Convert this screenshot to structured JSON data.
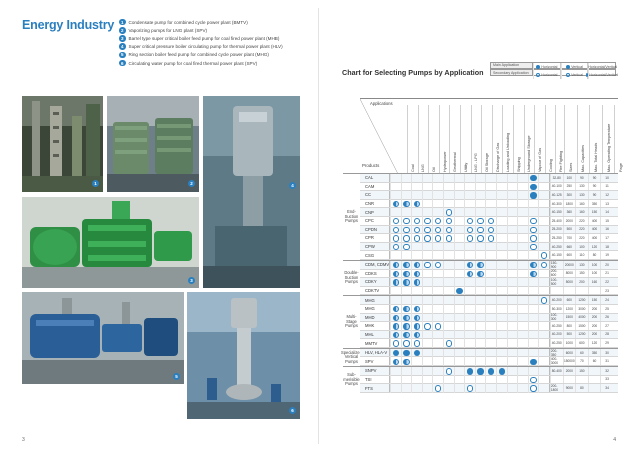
{
  "left": {
    "section_title": "Energy Industry",
    "legend": [
      {
        "num": "1",
        "text": "Condensate pump for combined cycle power plant (BMTV)"
      },
      {
        "num": "2",
        "text": "Vaporizing pumps for LNG plant (SPV)"
      },
      {
        "num": "3",
        "text": "Barrel type super critical boiler feed pump for coal fired power plant (MHB)"
      },
      {
        "num": "4",
        "text": "Super critical pressure boiler circulating pump for thermal power plant (HLV)"
      },
      {
        "num": "5",
        "text": "Ring section boiler feed pump for combined cycle power plant (MHG)"
      },
      {
        "num": "6",
        "text": "Circulating water pump for coal fired thermal power plant (SPV)"
      }
    ],
    "photos": [
      {
        "tag": "1"
      },
      {
        "tag": "2"
      },
      {
        "tag": "3"
      },
      {
        "tag": "4"
      },
      {
        "tag": "5"
      },
      {
        "tag": "6"
      }
    ],
    "page_number": "3"
  },
  "right": {
    "chart_title": "Chart for Selecting Pumps by Application",
    "app_legend": {
      "main_label": "Main Application",
      "secondary_label": "Secondary Application",
      "options": [
        "Horizontal",
        "Vertical",
        "Horizontal/Vertical"
      ]
    },
    "table_header": {
      "applications_label": "Applications",
      "products_label": "Products",
      "columns": [
        "Coal",
        "LNG",
        "Oil",
        "Hydropower",
        "Geothermal",
        "Utility",
        "LNG - LPG",
        "Oil Storage",
        "Discharge of Gas",
        "Loading and Unloading",
        "Shipping",
        "Underground Storage",
        "Vapour of Gas",
        "Cooling",
        "Fire Fighting"
      ],
      "spec_columns": [
        "Sizes",
        "Max. Capacities",
        "Max. Total Heads",
        "Max. Operating Temperature",
        "Page"
      ],
      "spec_units": [
        "mm",
        "m³/h",
        "m",
        "°C",
        ""
      ]
    },
    "groups": [
      {
        "label": "End-Suction Pumps",
        "rows": [
          {
            "name": "CAL",
            "marks": [
              "",
              "",
              "",
              "",
              "",
              "",
              "",
              "",
              "",
              "",
              "",
              "",
              "",
              "main",
              ""
            ],
            "specs": [
              "32-80",
              "100",
              "90",
              "90",
              "10"
            ]
          },
          {
            "name": "CAM",
            "marks": [
              "",
              "",
              "",
              "",
              "",
              "",
              "",
              "",
              "",
              "",
              "",
              "",
              "",
              "main",
              ""
            ],
            "specs": [
              "40-100",
              "250",
              "130",
              "90",
              "11"
            ]
          },
          {
            "name": "CC",
            "marks": [
              "",
              "",
              "",
              "",
              "",
              "",
              "",
              "",
              "",
              "",
              "",
              "",
              "",
              "main",
              ""
            ],
            "specs": [
              "40-125",
              "300",
              "130",
              "90",
              "12"
            ]
          },
          {
            "name": "CNR",
            "marks": [
              "both",
              "both",
              "both",
              "",
              "",
              "",
              "",
              "",
              "",
              "",
              "",
              "",
              "",
              "",
              ""
            ],
            "specs": [
              "40-300",
              "1800",
              "160",
              "350",
              "13"
            ]
          },
          {
            "name": "CNP",
            "marks": [
              "",
              "",
              "",
              "",
              "",
              "sec",
              "",
              "",
              "",
              "",
              "",
              "",
              "",
              "",
              ""
            ],
            "specs": [
              "40-150",
              "360",
              "160",
              "150",
              "14"
            ]
          },
          {
            "name": "CPC",
            "marks": [
              "sec",
              "sec",
              "sec",
              "sec",
              "sec",
              "sec",
              "",
              "sec",
              "sec",
              "sec",
              "",
              "",
              "",
              "sec",
              ""
            ],
            "specs": [
              "25-400",
              "2000",
              "220",
              "400",
              "15"
            ]
          },
          {
            "name": "CPDN",
            "marks": [
              "sec",
              "sec",
              "sec",
              "sec",
              "sec",
              "sec",
              "",
              "sec",
              "sec",
              "sec",
              "",
              "",
              "",
              "sec",
              ""
            ],
            "specs": [
              "25-200",
              "500",
              "220",
              "400",
              "16"
            ]
          },
          {
            "name": "CPR",
            "marks": [
              "sec",
              "sec",
              "sec",
              "sec",
              "sec",
              "sec",
              "",
              "sec",
              "sec",
              "sec",
              "",
              "",
              "",
              "sec",
              ""
            ],
            "specs": [
              "25-250",
              "700",
              "220",
              "400",
              "17"
            ]
          },
          {
            "name": "CPW",
            "marks": [
              "sec",
              "sec",
              "",
              "",
              "",
              "",
              "",
              "",
              "",
              "",
              "",
              "",
              "",
              "sec",
              ""
            ],
            "specs": [
              "40-250",
              "660",
              "100",
              "120",
              "18"
            ]
          },
          {
            "name": "CSG",
            "marks": [
              "",
              "",
              "",
              "",
              "",
              "",
              "",
              "",
              "",
              "",
              "",
              "",
              "",
              "",
              "sec"
            ],
            "specs": [
              "40-150",
              "600",
              "110",
              "80",
              "19"
            ]
          }
        ]
      },
      {
        "label": "Double-Suction Pumps",
        "rows": [
          {
            "name": "CDM, CDMV",
            "marks": [
              "both",
              "both",
              "both",
              "sec",
              "sec",
              "",
              "",
              "both",
              "both",
              "",
              "",
              "",
              "",
              "both",
              "sec"
            ],
            "specs": [
              "150-900",
              "20000",
              "130",
              "100",
              "20"
            ]
          },
          {
            "name": "CDKS",
            "marks": [
              "both",
              "both",
              "both",
              "",
              "",
              "",
              "",
              "both",
              "both",
              "",
              "",
              "",
              "",
              "both",
              ""
            ],
            "specs": [
              "200-600",
              "8000",
              "150",
              "100",
              "21"
            ]
          },
          {
            "name": "CDKY",
            "marks": [
              "both",
              "both",
              "both",
              "",
              "",
              "",
              "",
              "",
              "",
              "",
              "",
              "",
              "",
              "",
              ""
            ],
            "specs": [
              "100-500",
              "5000",
              "200",
              "160",
              "22"
            ]
          },
          {
            "name": "CDKTV",
            "marks": [
              "",
              "",
              "",
              "",
              "",
              "",
              "main",
              "",
              "",
              "",
              "",
              "",
              "",
              "",
              ""
            ],
            "specs": [
              "",
              "",
              "",
              "",
              "23"
            ]
          }
        ]
      },
      {
        "label": "Multi-Stage Pumps",
        "rows": [
          {
            "name": "MHG",
            "marks": [
              "",
              "",
              "",
              "",
              "",
              "",
              "",
              "",
              "",
              "",
              "",
              "",
              "",
              "",
              "sec"
            ],
            "specs": [
              "40-200",
              "600",
              "1200",
              "150",
              "24"
            ]
          },
          {
            "name": "MHG",
            "marks": [
              "both",
              "both",
              "both",
              "",
              "",
              "",
              "",
              "",
              "",
              "",
              "",
              "",
              "",
              "",
              ""
            ],
            "specs": [
              "50-300",
              "1200",
              "3000",
              "200",
              "25"
            ]
          },
          {
            "name": "MHD",
            "marks": [
              "both",
              "both",
              "both",
              "",
              "",
              "",
              "",
              "",
              "",
              "",
              "",
              "",
              "",
              "",
              ""
            ],
            "specs": [
              "100-300",
              "1500",
              "4000",
              "200",
              "26"
            ]
          },
          {
            "name": "MHK",
            "marks": [
              "both",
              "both",
              "both",
              "sec",
              "sec",
              "",
              "",
              "",
              "",
              "",
              "",
              "",
              "",
              "",
              ""
            ],
            "specs": [
              "40-250",
              "800",
              "1500",
              "200",
              "27"
            ]
          },
          {
            "name": "MHL",
            "marks": [
              "both",
              "both",
              "both",
              "",
              "",
              "",
              "",
              "",
              "",
              "",
              "",
              "",
              "",
              "",
              ""
            ],
            "specs": [
              "40-200",
              "500",
              "1200",
              "200",
              "28"
            ]
          },
          {
            "name": "MMTV",
            "marks": [
              "sec",
              "sec",
              "sec",
              "",
              "",
              "sec",
              "",
              "",
              "",
              "",
              "",
              "",
              "",
              "",
              ""
            ],
            "specs": [
              "40-250",
              "1000",
              "600",
              "120",
              "29"
            ]
          }
        ]
      },
      {
        "label": "Specialized Vertical Pumps",
        "rows": [
          {
            "name": "HLV, HLA-V",
            "marks": [
              "main",
              "main",
              "main",
              "",
              "",
              "",
              "",
              "",
              "",
              "",
              "",
              "",
              "",
              "",
              ""
            ],
            "specs": [
              "200-350",
              "6000",
              "60",
              "350",
              "30"
            ]
          },
          {
            "name": "SPV",
            "marks": [
              "both",
              "both",
              "",
              "",
              "",
              "",
              "",
              "",
              "",
              "",
              "",
              "",
              "",
              "main",
              ""
            ],
            "specs": [
              "400-3000",
              "150000",
              "70",
              "60",
              "31"
            ]
          }
        ]
      },
      {
        "label": "Sub-merisible Pumps",
        "rows": [
          {
            "name": "SNPV",
            "marks": [
              "",
              "",
              "",
              "",
              "",
              "sec",
              "",
              "main",
              "main",
              "main",
              "main",
              "",
              "",
              "",
              ""
            ],
            "specs": [
              "80-400",
              "2000",
              "150",
              "",
              "32"
            ]
          },
          {
            "name": "TSI",
            "marks": [
              "",
              "",
              "",
              "",
              "",
              "",
              "",
              "",
              "",
              "",
              "",
              "",
              "",
              "sec",
              ""
            ],
            "specs": [
              "",
              "",
              "",
              "",
              "33"
            ]
          },
          {
            "name": "FTS",
            "marks": [
              "",
              "",
              "",
              "",
              "sec",
              "",
              "",
              "sec",
              "",
              "",
              "",
              "",
              "",
              "sec",
              ""
            ],
            "specs": [
              "200-1800",
              "9000",
              "80",
              "",
              "34"
            ]
          }
        ]
      }
    ],
    "page_number": "4"
  },
  "colors": {
    "accent": "#2a7fbf",
    "accent_light": "#bcd8ee",
    "row_tint": "#f1f6fb"
  }
}
